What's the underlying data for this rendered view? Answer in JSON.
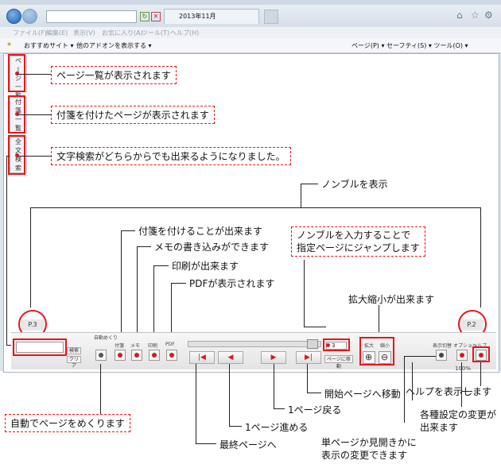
{
  "browser": {
    "tab_title": "2013年11月",
    "menu": [
      "ファイル(F)",
      "編集(E)",
      "表示(V)",
      "お気に入り(A)",
      "ツール(T)",
      "ヘルプ(H)"
    ],
    "favorites": [
      "おすすめサイト ▾",
      "他のアドオンを表示する ▾"
    ],
    "command_bar": "ページ(P) ▾  セーフティ(S) ▾  ツール(O) ▾"
  },
  "sidebar": {
    "tab1": "ペ\n|\nジ\n一\n覧",
    "tab2": "付\n箋\n一\n覧",
    "tab3": "全\n文\n検\n索"
  },
  "callouts": {
    "page_list": "ページ一覧が表示されます",
    "sticky_list": "付箋を付けたページが表示されます",
    "search": "文字検索がどちらからでも出来るようになりました。",
    "jump": "ノンブルを入力することで\n指定ページにジャンプします",
    "auto_flip": "自動でページをめくります"
  },
  "labels": {
    "nombre": "ノンブルを表示",
    "sticky": "付箋を付けることが出来ます",
    "memo": "メモの書き込みができます",
    "print": "印刷が出来ます",
    "pdf": "PDFが表示されます",
    "zoom": "拡大縮小が出来ます",
    "help": "ヘルプを表示します",
    "first_page": "開始ページへ移動",
    "prev_page": "1ページ戻る",
    "next_page": "1ページ進める",
    "last_page": "最終ページへ",
    "settings": "各種設定の変更が\n出来ます",
    "display_mode": "単ページか見開きかに\n表示の変更できます"
  },
  "page_numbers": {
    "left": "P.3",
    "right": "P.2"
  },
  "toolbar": {
    "search_btn": "検索",
    "clear_btn": "クリア",
    "auto_label": "自動めくり",
    "sticky_label": "付箋",
    "memo_label": "メモ",
    "print_label": "印刷",
    "pdf_label": "PDF",
    "page_input": "3",
    "jump_btn": "ページに移動",
    "zoom_in": "拡大",
    "zoom_out": "縮小",
    "display_label": "表示切替",
    "option_label": "オプション",
    "help_label": "ヘルプ",
    "zoom_level": "100%"
  },
  "colors": {
    "accent": "#e8161b",
    "frame": "#dde4ec"
  }
}
